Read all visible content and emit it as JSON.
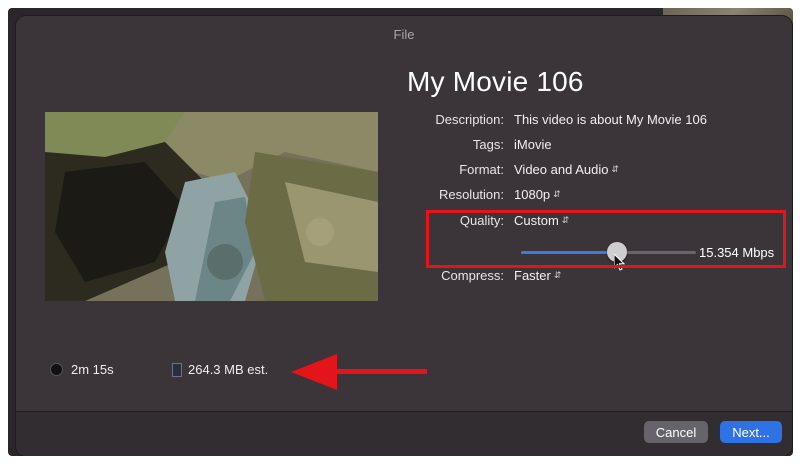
{
  "window": {
    "title": "File"
  },
  "movie": {
    "title": "My Movie 106"
  },
  "fields": [
    {
      "label": "Description:",
      "value": "This video is about My Movie 106",
      "dropdown": false
    },
    {
      "label": "Tags:",
      "value": "iMovie",
      "dropdown": false
    },
    {
      "label": "Format:",
      "value": "Video and Audio",
      "dropdown": true
    },
    {
      "label": "Resolution:",
      "value": "1080p",
      "dropdown": true
    },
    {
      "label": "Quality:",
      "value": "Custom",
      "dropdown": true
    },
    {
      "label": "Compress:",
      "value": "Faster",
      "dropdown": true
    }
  ],
  "quality_slider": {
    "fraction": 0.55,
    "bitrate_text": "15.354 Mbps"
  },
  "stats": {
    "duration": "2m 15s",
    "size": "264.3 MB est."
  },
  "buttons": {
    "cancel": "Cancel",
    "next": "Next..."
  },
  "colors": {
    "accent": "#2f72e6",
    "annotation": "#e3141a",
    "dialog_bg": "#3b3539"
  },
  "icons": {
    "dropdown": "up-down-chevron-icon",
    "duration": "clock-icon",
    "size": "file-icon",
    "cursor": "mouse-pointer-icon"
  }
}
